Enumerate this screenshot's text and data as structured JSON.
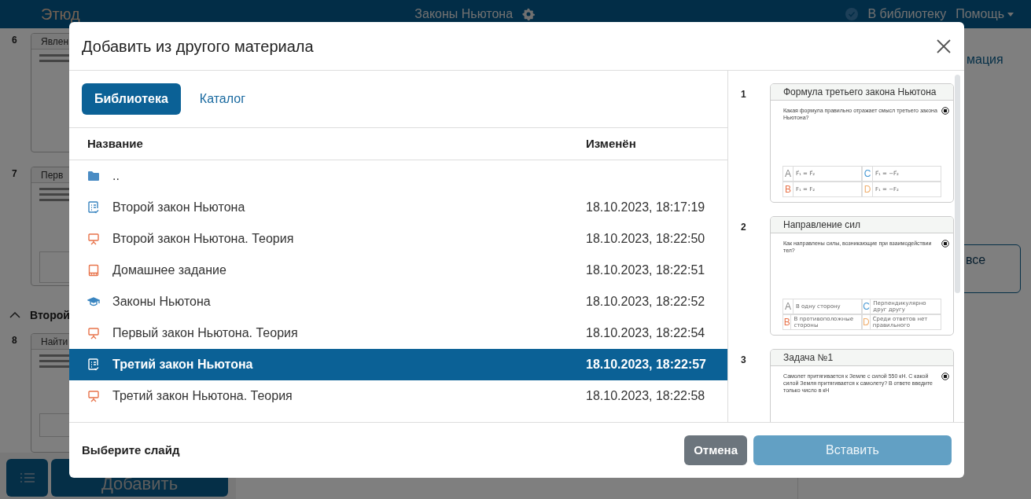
{
  "app_bar": {
    "logo": "Этюд",
    "title": "Законы Ньютона",
    "library_link": "В библиотеку",
    "help_menu": "Помощь"
  },
  "background": {
    "slides": [
      {
        "number": "6",
        "title": "Явлен",
        "kind": "text"
      },
      {
        "number": "7",
        "title": "Перв",
        "kind": "choice"
      },
      {
        "kind": "section",
        "title": "Второй"
      },
      {
        "number": "8",
        "title": "Найти",
        "kind": "input"
      }
    ],
    "right_heading": "мация",
    "right_button": "все",
    "add_button": "Добавить"
  },
  "dialog": {
    "title": "Добавить из другого материала",
    "tabs": [
      {
        "label": "Библиотека",
        "selected": true
      },
      {
        "label": "Каталог",
        "selected": false
      }
    ],
    "columns": [
      "Название",
      "Изменён"
    ],
    "rows": [
      {
        "kind": "folder",
        "name": "..",
        "selected": false
      },
      {
        "kind": "test",
        "name": "Второй закон Ньютона",
        "modified": "18.10.2023, 18:17:19",
        "selected": false
      },
      {
        "kind": "presentation",
        "name": "Второй закон Ньютона. Теория",
        "modified": "18.10.2023, 18:22:50",
        "selected": false
      },
      {
        "kind": "book",
        "name": "Домашнее задание",
        "modified": "18.10.2023, 18:22:51",
        "selected": false
      },
      {
        "kind": "course",
        "name": "Законы Ньютона",
        "modified": "18.10.2023, 18:22:52",
        "selected": false
      },
      {
        "kind": "presentation",
        "name": "Первый закон Ньютона. Теория",
        "modified": "18.10.2023, 18:22:54",
        "selected": false
      },
      {
        "kind": "test",
        "name": "Третий закон Ньютона",
        "modified": "18.10.2023, 18:22:57",
        "selected": true
      },
      {
        "kind": "presentation",
        "name": "Третий закон Ньютона. Теория",
        "modified": "18.10.2023, 18:22:58",
        "selected": false
      }
    ],
    "slides": [
      {
        "number": "1",
        "title": "Формула третьего закона Ньютона",
        "question": "Какая формула правильно отражает смысл третьего закона Ньютона?",
        "options": [
          {
            "letter": "A",
            "text": "F⃗₁ = F⃗₂",
            "color": "#8a8a8a"
          },
          {
            "letter": "C",
            "text": "F⃗₁ = −F⃗₂",
            "color": "#4a9ad4"
          },
          {
            "letter": "B",
            "text": "F₁ = F₂",
            "color": "#e8734a"
          },
          {
            "letter": "D",
            "text": "F₁ = −F₂",
            "color": "#f0b070"
          }
        ]
      },
      {
        "number": "2",
        "title": "Направление сил",
        "question": "Как направлены силы, возникающие при взаимодействии тел?",
        "options": [
          {
            "letter": "A",
            "text": "В одну сторону",
            "color": "#8a8a8a"
          },
          {
            "letter": "C",
            "text": "Перпендикулярно друг другу",
            "color": "#4a9ad4"
          },
          {
            "letter": "B",
            "text": "В противоположные стороны",
            "color": "#e8734a"
          },
          {
            "letter": "D",
            "text": "Среди ответов нет правильного",
            "color": "#f0b070"
          }
        ]
      },
      {
        "number": "3",
        "title": "Задача №1",
        "question": "Самолет притягивается к Земле с силой 550 кН. С какой силой Земля притягивается к самолету? В ответе введите только число в кН"
      }
    ],
    "status": "Выберите слайд",
    "cancel_button": "Отмена",
    "insert_button": {
      "label": "Вставить",
      "disabled": true
    }
  }
}
